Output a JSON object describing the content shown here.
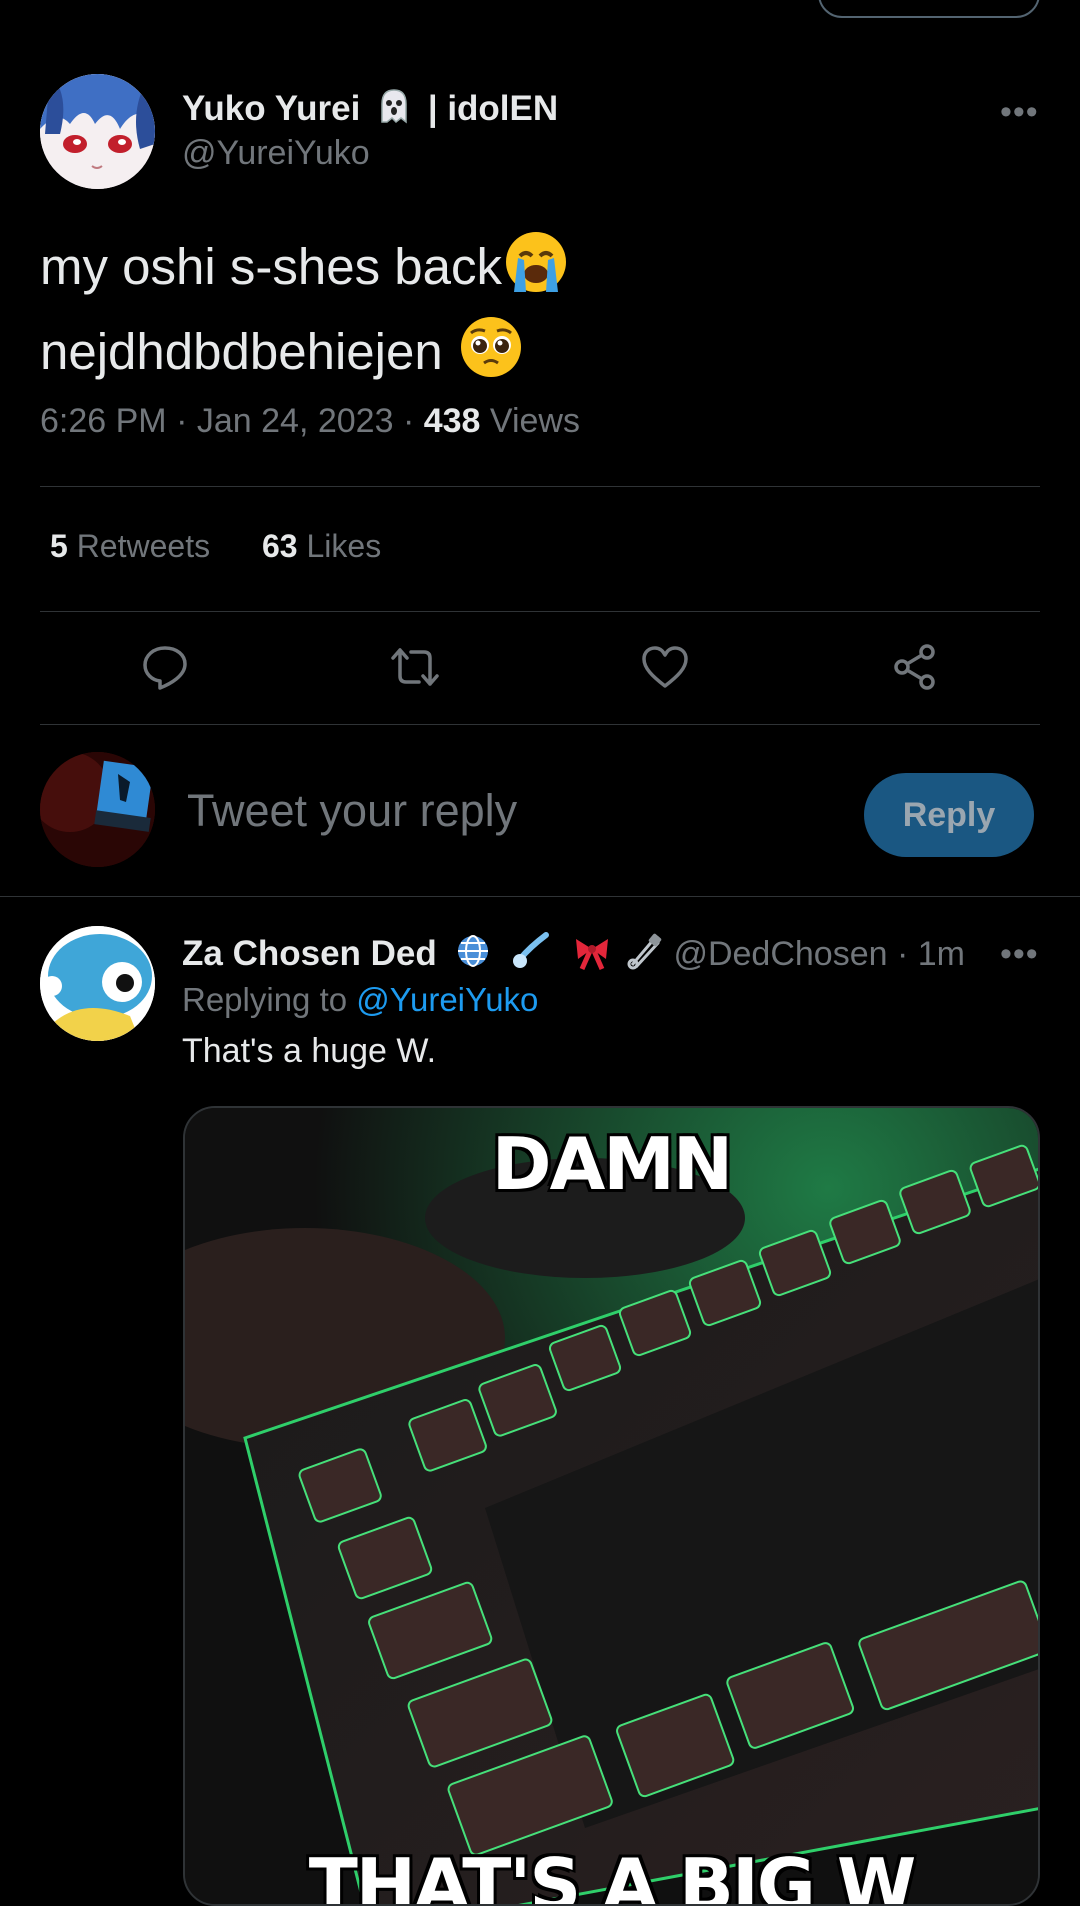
{
  "tweet": {
    "author_name": "Yuko Yurei",
    "author_suffix": "| idolEN",
    "author_handle": "@YureiYuko",
    "more": "•••",
    "text_line1": "my oshi s-shes back",
    "text_line2": "nejdhdbdbehiejen",
    "time": "6:26 PM",
    "date": "Jan 24, 2023",
    "views_count": "438",
    "views_label": "Views",
    "sep": "·"
  },
  "stats": {
    "retweets_count": "5",
    "retweets_label": "Retweets",
    "likes_count": "63",
    "likes_label": "Likes"
  },
  "reply_box": {
    "placeholder": "Tweet your reply",
    "button": "Reply"
  },
  "reply": {
    "author_name": "Za Chosen Ded",
    "author_handle": "@DedChosen",
    "time": "1m",
    "sep": "·",
    "more": "•••",
    "replying_prefix": "Replying to",
    "replying_to": "@YureiYuko",
    "text": "That's a huge W.",
    "meme_top": "DAMN",
    "meme_bottom": "THAT'S A BIG W"
  },
  "colors": {
    "accent": "#1d9bf0",
    "reply_button": "#1a5782",
    "muted": "#71767b",
    "divider": "#2f3336"
  },
  "icons": [
    "ghost-icon",
    "reply-icon",
    "retweet-icon",
    "like-icon",
    "share-icon",
    "globe-icon",
    "comet-icon",
    "ribbon-icon",
    "safety-pin-icon",
    "loudly-crying-face-icon",
    "pleading-face-icon"
  ]
}
